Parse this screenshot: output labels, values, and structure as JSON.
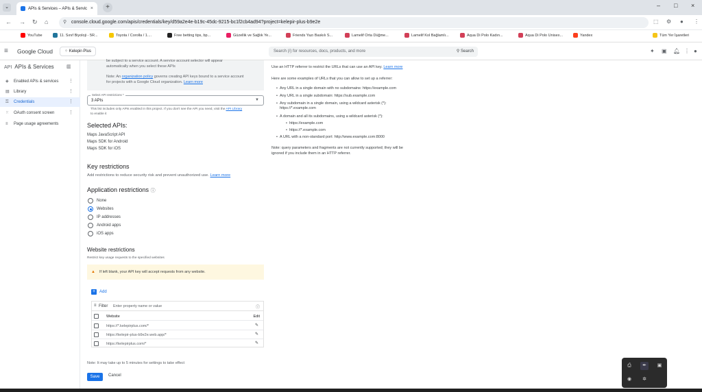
{
  "browser": {
    "tab_title": "APIs & Services – APIs & Servic",
    "url": "console.cloud.google.com/apis/credentials/key/d59a2e4e-b19c-45dc-9215-bc1f2cb4ad94?project=kelepir-plus-b9e2e",
    "bookmarks": [
      {
        "label": "YouTube",
        "color": "#ff0000"
      },
      {
        "label": "11. Sınıf Biyoloji - 5R...",
        "color": "#21759b"
      },
      {
        "label": "Toyota / Corolla / 1....",
        "color": "#f6c700"
      },
      {
        "label": "Free betting tips, bp...",
        "color": "#222222"
      },
      {
        "label": "Güzellik ve Sağlık Ye...",
        "color": "#e91e63"
      },
      {
        "label": "Friends Yazı Baskılı S...",
        "color": "#d23f57"
      },
      {
        "label": "Lamelif Orta Düğme...",
        "color": "#d23f57"
      },
      {
        "label": "Lamelif Kol Bağlamlı...",
        "color": "#d23f57"
      },
      {
        "label": "Aqua Di Polo Kadın...",
        "color": "#d23f57"
      },
      {
        "label": "Aqua Di Polo Unisex...",
        "color": "#d23f57"
      },
      {
        "label": "Yandex",
        "color": "#fc3f1d"
      }
    ],
    "all_bookmarks": "Tüm Yer İşaretleri"
  },
  "header": {
    "logo": "Google Cloud",
    "project": "Kelepir-Plus",
    "search_placeholder": "Search (/) for resources, docs, products, and more",
    "search_button": "Search"
  },
  "sidebar": {
    "title": "APIs & Services",
    "items": [
      {
        "label": "Enabled APIs & services"
      },
      {
        "label": "Library"
      },
      {
        "label": "Credentials"
      },
      {
        "label": "OAuth consent screen"
      },
      {
        "label": "Page usage agreements"
      }
    ]
  },
  "main": {
    "graybox_line1": "be subject to a service account. A service account selector will appear",
    "graybox_line2": "automatically when you select these APIs",
    "note_prefix": "Note: An",
    "note_link": "organization policy",
    "note_rest": "governs creating API keys bound to a service account",
    "note_line2": "for projects with a Google Cloud organization.",
    "learn_more": "Learn more",
    "select_label": "Select API restrictions *",
    "select_value": "3 APIs",
    "select_help1": "This list includes only APIs enabled in this project. If you don't see the API you need, visit the",
    "select_help_link": "API Library",
    "select_help2": "to enable it",
    "selected_apis_title": "Selected APIs:",
    "selected_apis": [
      "Maps JavaScript API",
      "Maps SDK for Android",
      "Maps SDK for iOS"
    ],
    "key_restrictions_title": "Key restrictions",
    "key_restrictions_desc": "Add restrictions to reduce security risk and prevent unauthorized use.",
    "app_restrictions_title": "Application restrictions",
    "app_options": [
      "None",
      "Websites",
      "IP addresses",
      "Android apps",
      "iOS apps"
    ],
    "website_restrictions_title": "Website restrictions",
    "website_restrictions_desc": "Restrict key usage requests to the specified websites",
    "warning": "If left blank, your API key will accept requests from any website.",
    "add_label": "Add",
    "filter_label": "Filter",
    "filter_placeholder": "Enter property name or value",
    "col_website": "Website",
    "col_edit": "Edit",
    "websites": [
      "https://*.kelepirplus.com/*",
      "https://kelepir-plus-b9e2e.web.app/*",
      "https://kelepirplus.com/*"
    ],
    "note_bottom": "Note: It may take up to 5 minutes for settings to take effect",
    "save": "Save",
    "cancel": "Cancel"
  },
  "help": {
    "intro": "Use an HTTP referrer to restrict the URLs that can use an API key.",
    "learn_more": "Learn more",
    "examples_title": "Here are some examples of URLs that you can allow to set up a referrer:",
    "ex1": "Any URL in a single domain with no subdomains: https://example.com",
    "ex2": "Any URL in a single subdomain: https://sub.example.com",
    "ex3a": "Any subdomain in a single domain, using a wildcard asterisk (*):",
    "ex3b": "https://*.example.com",
    "ex4": "A domain and all its subdomains, using a wildcard asterisk (*):",
    "ex4a": "https://example.com",
    "ex4b": "https://*.example.com",
    "ex5": "A URL with a non-standard port: http://www.example.com:8000",
    "note1": "Note: query parameters and fragments are not currently supported; they will be",
    "note2": "ignored if you include them in an HTTP referrer."
  }
}
